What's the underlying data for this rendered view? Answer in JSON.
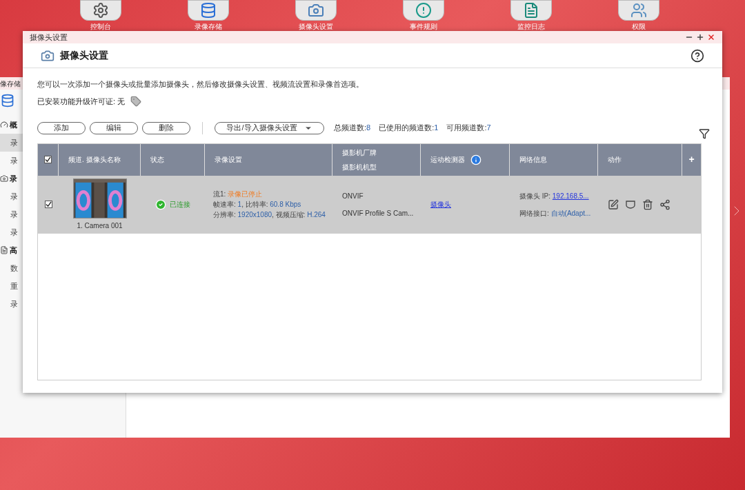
{
  "desktop_apps": [
    {
      "label": "控制台",
      "kind": "gear"
    },
    {
      "label": "录像存储",
      "kind": "storage"
    },
    {
      "label": "摄像头设置",
      "kind": "camera"
    },
    {
      "label": "事件规则",
      "kind": "event"
    },
    {
      "label": "监控日志",
      "kind": "log"
    },
    {
      "label": "权限",
      "kind": "users"
    }
  ],
  "back_window": {
    "title": "像存储",
    "sidebar": [
      {
        "label": "概",
        "kind": "gauge",
        "children": [
          {
            "label": "录",
            "selected": true
          },
          {
            "label": "录",
            "selected": false
          }
        ]
      },
      {
        "label": "录",
        "kind": "camera",
        "children": [
          {
            "label": "录",
            "selected": false
          },
          {
            "label": "录",
            "selected": false
          },
          {
            "label": "录",
            "selected": false
          }
        ]
      },
      {
        "label": "高",
        "kind": "doc",
        "children": [
          {
            "label": "数",
            "selected": false
          },
          {
            "label": "重",
            "selected": false
          },
          {
            "label": "录",
            "selected": false
          }
        ]
      }
    ]
  },
  "window": {
    "title": "摄像头设置",
    "heading": "摄像头设置",
    "description": "您可以一次添加一个摄像头或批量添加摄像头，然后修改摄像头设置、视频流设置和录像首选项。",
    "license": {
      "label": "已安装功能升级许可证: 无"
    },
    "buttons": [
      "添加",
      "编辑",
      "删除"
    ],
    "dropdown": "导出/导入摄像头设置",
    "counts": [
      {
        "label": "总频道数:",
        "value": "8"
      },
      {
        "label": "已使用的频道数:",
        "value": "1"
      },
      {
        "label": "可用频道数:",
        "value": "7"
      }
    ],
    "table": {
      "header_checked": true,
      "columns": [
        {
          "lines": [
            "频道. 摄像头名称"
          ]
        },
        {
          "lines": [
            "状态"
          ]
        },
        {
          "lines": [
            "录像设置"
          ]
        },
        {
          "lines": [
            "摄影机厂牌",
            "摄影机机型"
          ]
        },
        {
          "lines": [
            "运动检测器"
          ],
          "info": true
        },
        {
          "lines": [
            "网络信息"
          ]
        },
        {
          "lines": [
            "动作"
          ]
        }
      ],
      "add_column": "+",
      "rows": [
        {
          "checked": true,
          "selected": true,
          "name": "1. Camera 001",
          "status": {
            "kind": "connected",
            "text": "已连接"
          },
          "recording": [
            [
              {
                "kind": "label",
                "text": "流1: "
              },
              {
                "kind": "alert",
                "text": "录像已停止"
              }
            ],
            [
              {
                "kind": "label",
                "text": "帧速率: "
              },
              {
                "kind": "value",
                "text": "1"
              },
              {
                "kind": "label",
                "text": ", 比特率: "
              },
              {
                "kind": "value",
                "text": "60.8 Kbps"
              }
            ],
            [
              {
                "kind": "label",
                "text": "分辨率: "
              },
              {
                "kind": "value",
                "text": "1920x1080"
              },
              {
                "kind": "label",
                "text": ", 视频压缩: "
              },
              {
                "kind": "value",
                "text": "H.264"
              }
            ]
          ],
          "brand": "ONVIF",
          "model": "ONVIF Profile S Cam...",
          "motion": "摄像头",
          "ip_label": "摄像头 IP: ",
          "ip": "192.168.5...",
          "iface_label": "网络接口: ",
          "iface": "自动(Adapt...",
          "actions": [
            {
              "kind": "edit"
            },
            {
              "kind": "monitor"
            },
            {
              "kind": "delete"
            },
            {
              "kind": "share"
            }
          ]
        }
      ]
    }
  }
}
